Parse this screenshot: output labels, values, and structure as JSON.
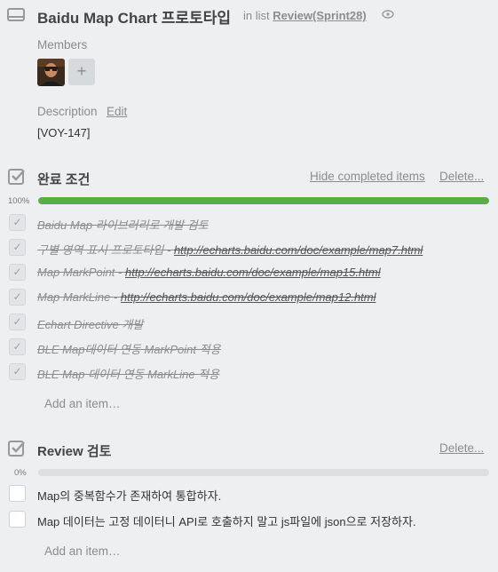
{
  "header": {
    "title": "Baidu Map Chart 프로토타입",
    "in_list_prefix": "in list",
    "list_name": "Review(Sprint28)",
    "card_icon": "card-icon",
    "watch_icon": "eye-icon"
  },
  "members": {
    "label": "Members",
    "add_label": "+"
  },
  "description": {
    "label": "Description",
    "edit_label": "Edit",
    "text": "[VOY-147]"
  },
  "checklists": [
    {
      "title": "완료 조건",
      "hide_label": "Hide completed items",
      "delete_label": "Delete...",
      "percent_label": "100%",
      "progress": 1.0,
      "bar_color": "#5aac44",
      "items": [
        {
          "text": "Baidu Map 라이브러리로 개발 검토",
          "link": "",
          "done": true
        },
        {
          "text": "구별 영역 표시 프로토타입 - ",
          "link": "http://echarts.baidu.com/doc/example/map7.html",
          "done": true
        },
        {
          "text": "Map MarkPoint - ",
          "link": "http://echarts.baidu.com/doc/example/map15.html",
          "done": true
        },
        {
          "text": "Map MarkLine - ",
          "link": "http://echarts.baidu.com/doc/example/map12.html",
          "done": true
        },
        {
          "text": "Echart Directive 개발",
          "link": "",
          "done": true
        },
        {
          "text": "BLE Map데이터 연동 MarkPoint 적용",
          "link": "",
          "done": true
        },
        {
          "text": "BLE Map 데이터 연동 MarkLine 적용",
          "link": "",
          "done": true
        }
      ],
      "add_item_label": "Add an item…"
    },
    {
      "title": "Review 검토",
      "delete_label": "Delete...",
      "percent_label": "0%",
      "progress": 0.0,
      "bar_color": "#5aac44",
      "items": [
        {
          "text": "Map의 중복함수가 존재하여 통합하자.",
          "done": false
        },
        {
          "text": "Map 데이터는 고정 데이터니 API로 호출하지 말고 js파일에 json으로 저장하자.",
          "done": false
        }
      ],
      "add_item_label": "Add an item…"
    }
  ]
}
